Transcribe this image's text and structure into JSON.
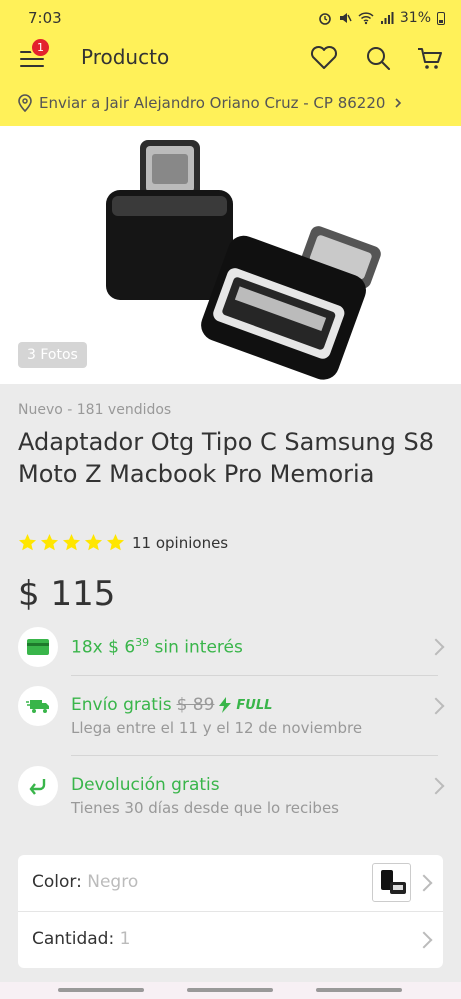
{
  "status_bar": {
    "time": "7:03",
    "battery": "31%",
    "icons": [
      "alarm-icon",
      "mute-icon",
      "wifi-icon",
      "signal-icon",
      "battery-icon"
    ]
  },
  "app_bar": {
    "title": "Producto",
    "notification_count": "1",
    "background": "#fff159",
    "icons": [
      "menu-icon",
      "heart-icon",
      "search-icon",
      "cart-icon"
    ]
  },
  "shipping_address": {
    "text": "Enviar a Jair Alejandro Oriano Cruz - CP 86220",
    "icon": "location-pin-icon"
  },
  "gallery": {
    "photo_count": "3 Fotos"
  },
  "product": {
    "condition": "Nuevo - 181 vendidos",
    "title": "Adaptador Otg Tipo C Samsung S8 Moto Z Macbook Pro Memoria",
    "rating": 5,
    "reviews": "11 opiniones",
    "price": "$ 115"
  },
  "installments": {
    "text": "18x $ 6",
    "cents": "39",
    "suffix": "sin interés",
    "icon": "credit-card-icon"
  },
  "shipping": {
    "title": "Envío gratis",
    "old_price": "$ 89",
    "badge": "FULL",
    "subtitle": "Llega entre el 11 y el 12 de noviembre",
    "icon": "truck-icon"
  },
  "returns": {
    "title": "Devolución gratis",
    "subtitle": "Tienes 30 días desde que lo recibes",
    "icon": "return-arrow-icon"
  },
  "options": {
    "color_label": "Color:",
    "color_value": "Negro",
    "quantity_label": "Cantidad:",
    "quantity_value": "1"
  },
  "colors": {
    "accent_yellow": "#fff159",
    "success_green": "#39b54a",
    "star": "#ffe600",
    "badge_red": "#e3222d"
  }
}
